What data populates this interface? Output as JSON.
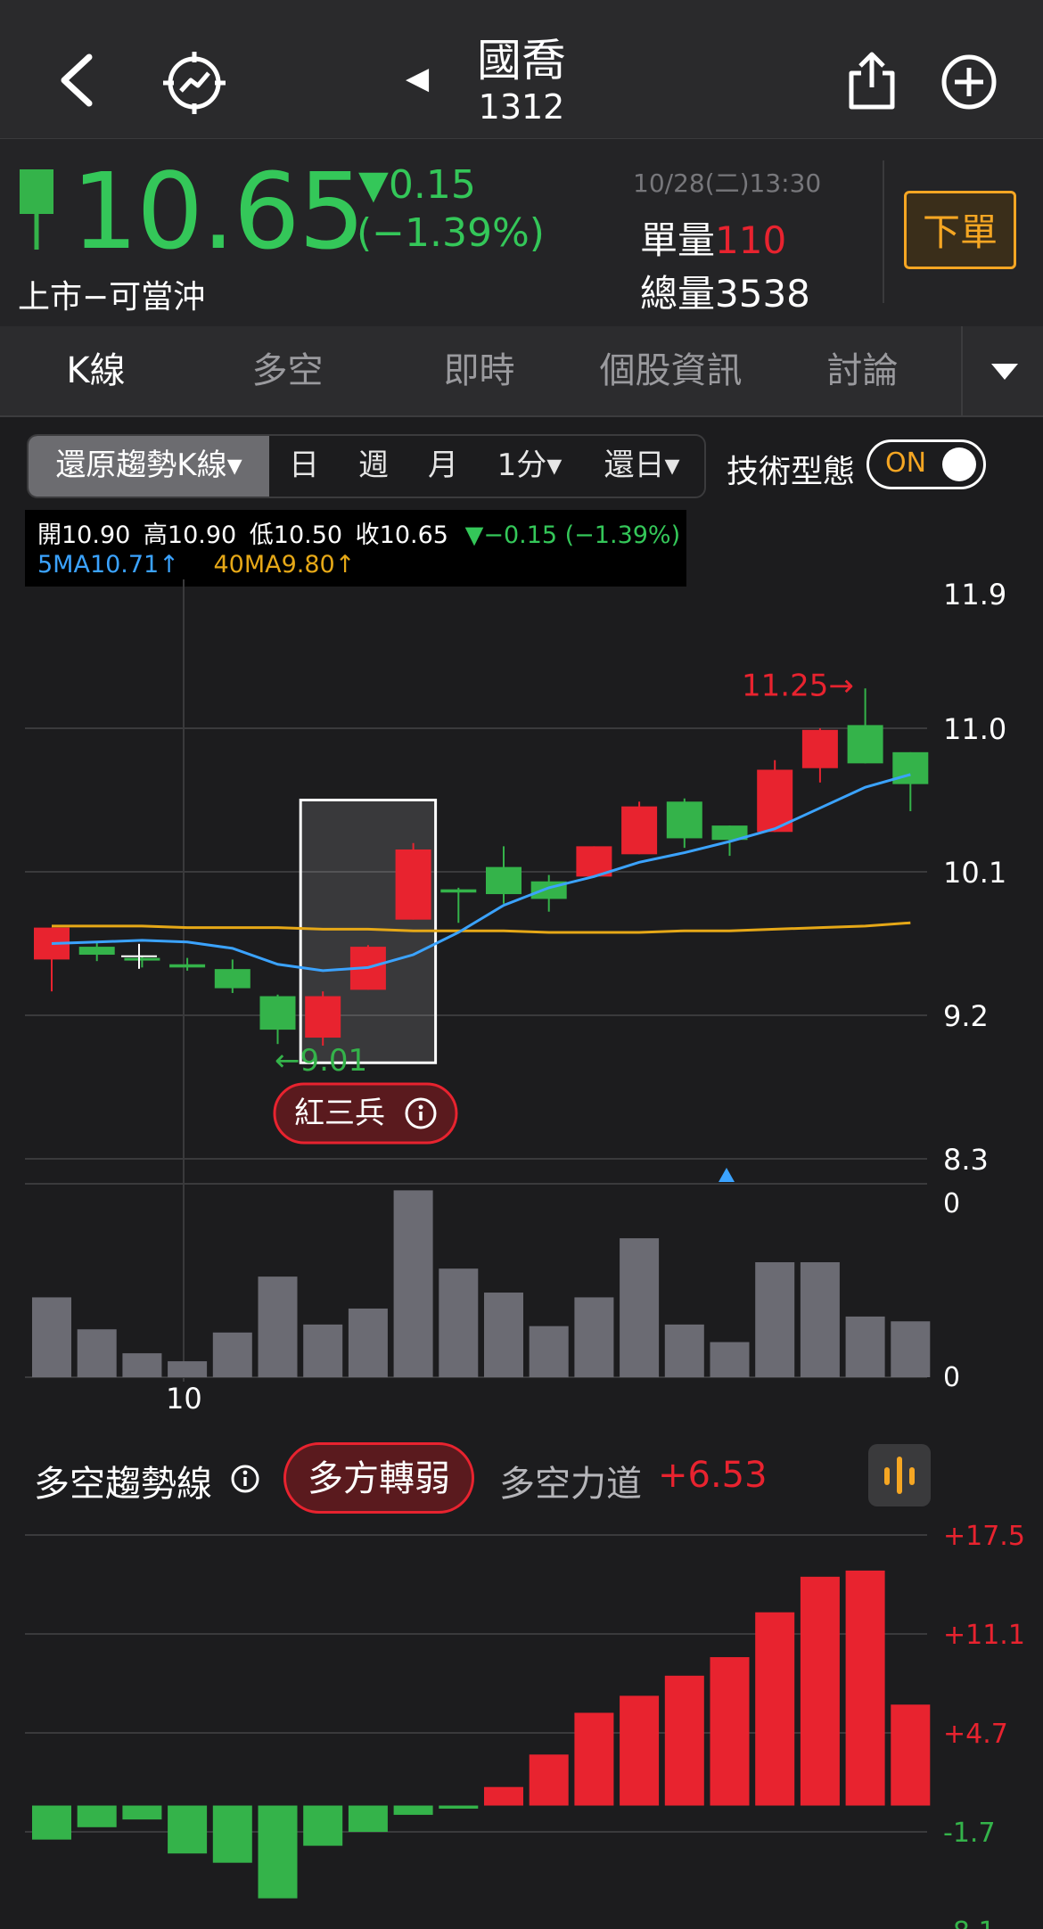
{
  "header": {
    "stock_name": "國喬",
    "stock_code": "1312",
    "prev_arrow": "◀",
    "icons": [
      "back-icon",
      "trend-target-icon",
      "share-icon",
      "add-icon"
    ]
  },
  "quote": {
    "price": "10.65",
    "change": "▼0.15",
    "change_pct": "(−1.39%)",
    "market": "上市−可當沖",
    "datetime": "10/28(二)13:30",
    "unit_volume_label": "單量",
    "unit_volume": "110",
    "total_volume_label": "總量",
    "total_volume": "3538",
    "order_button": "下單"
  },
  "tabs": [
    "K線",
    "多空",
    "即時",
    "個股資訊",
    "討論"
  ],
  "toolbar": {
    "kline_mode": "還原趨勢K線▾",
    "periods": [
      "日",
      "週",
      "月",
      "1分▾",
      "還日▾"
    ],
    "tech_label": "技術型態",
    "toggle": "ON"
  },
  "ohlc_bar": {
    "open": "開10.90",
    "high": "高10.90",
    "low": "低10.50",
    "close": "收10.65",
    "change": "▼−0.15 (−1.39%)",
    "ma5": "5MA10.71↑",
    "ma40": "40MA9.80↑"
  },
  "price_chart": {
    "y_ticks": [
      "11.9",
      "11.0",
      "10.1",
      "9.2",
      "8.3"
    ],
    "x_label": "10",
    "high_annotation": "11.25→",
    "low_annotation": "←9.01",
    "pattern_label": "紅三兵",
    "vol_ticks": [
      "0",
      "0"
    ]
  },
  "chart_data": [
    {
      "type": "candlestick",
      "ylim": [
        8.3,
        11.9
      ],
      "candles": [
        {
          "o": 9.55,
          "h": 9.71,
          "l": 9.35,
          "c": 9.75,
          "dir": "up"
        },
        {
          "o": 9.63,
          "h": 9.66,
          "l": 9.54,
          "c": 9.58,
          "dir": "down"
        },
        {
          "o": 9.56,
          "h": 9.57,
          "l": 9.5,
          "c": 9.56,
          "dir": "down"
        },
        {
          "o": 9.52,
          "h": 9.56,
          "l": 9.48,
          "c": 9.5,
          "dir": "down"
        },
        {
          "o": 9.49,
          "h": 9.55,
          "l": 9.34,
          "c": 9.37,
          "dir": "down"
        },
        {
          "o": 9.32,
          "h": 9.33,
          "l": 9.02,
          "c": 9.11,
          "dir": "down"
        },
        {
          "o": 9.06,
          "h": 9.35,
          "l": 9.01,
          "c": 9.32,
          "dir": "up"
        },
        {
          "o": 9.36,
          "h": 9.64,
          "l": 9.36,
          "c": 9.63,
          "dir": "up"
        },
        {
          "o": 9.8,
          "h": 10.28,
          "l": 9.8,
          "c": 10.24,
          "dir": "up"
        },
        {
          "o": 9.99,
          "h": 10.0,
          "l": 9.78,
          "c": 9.97,
          "dir": "down"
        },
        {
          "o": 10.13,
          "h": 10.26,
          "l": 9.9,
          "c": 9.96,
          "dir": "down"
        },
        {
          "o": 10.04,
          "h": 10.08,
          "l": 9.85,
          "c": 9.93,
          "dir": "down"
        },
        {
          "o": 10.07,
          "h": 10.19,
          "l": 10.07,
          "c": 10.26,
          "dir": "up"
        },
        {
          "o": 10.21,
          "h": 10.54,
          "l": 10.21,
          "c": 10.51,
          "dir": "up"
        },
        {
          "o": 10.54,
          "h": 10.56,
          "l": 10.25,
          "c": 10.31,
          "dir": "down"
        },
        {
          "o": 10.39,
          "h": 10.39,
          "l": 10.2,
          "c": 10.3,
          "dir": "down"
        },
        {
          "o": 10.35,
          "h": 10.8,
          "l": 10.35,
          "c": 10.74,
          "dir": "up"
        },
        {
          "o": 10.75,
          "h": 11.0,
          "l": 10.66,
          "c": 10.99,
          "dir": "up"
        },
        {
          "o": 11.02,
          "h": 11.25,
          "l": 10.78,
          "c": 10.78,
          "dir": "down"
        },
        {
          "o": 10.85,
          "h": 10.85,
          "l": 10.48,
          "c": 10.65,
          "dir": "down"
        }
      ],
      "ma5": [
        9.65,
        9.66,
        9.67,
        9.66,
        9.62,
        9.52,
        9.48,
        9.5,
        9.58,
        9.72,
        9.89,
        10.0,
        10.07,
        10.16,
        10.22,
        10.29,
        10.37,
        10.5,
        10.63,
        10.71
      ],
      "ma40": [
        9.76,
        9.76,
        9.76,
        9.75,
        9.75,
        9.75,
        9.74,
        9.74,
        9.73,
        9.73,
        9.73,
        9.72,
        9.72,
        9.72,
        9.73,
        9.73,
        9.74,
        9.75,
        9.76,
        9.78
      ]
    },
    {
      "type": "bar",
      "name": "volume",
      "values": [
        5.0,
        3.0,
        1.5,
        1.0,
        2.8,
        6.3,
        3.3,
        4.3,
        11.7,
        6.8,
        5.3,
        3.2,
        5.0,
        8.7,
        3.3,
        2.2,
        7.2,
        7.2,
        3.8,
        3.5
      ]
    },
    {
      "type": "bar",
      "name": "多空力道",
      "y_ticks": [
        "+17.5",
        "+11.1",
        "+4.7",
        "-1.7",
        "-8.1"
      ],
      "ylim": [
        -8.1,
        17.5
      ],
      "values": [
        -2.2,
        -1.4,
        -0.9,
        -3.1,
        -3.7,
        -6.0,
        -2.6,
        -1.7,
        -0.6,
        -0.2,
        1.2,
        3.3,
        6.0,
        7.1,
        8.4,
        9.6,
        12.5,
        14.8,
        15.2,
        6.53
      ]
    }
  ],
  "trend_section": {
    "title": "多空趨勢線",
    "badge": "多方轉弱",
    "strength_label": "多空力道",
    "strength_value": "+6.53"
  },
  "colors": {
    "up": "#e8232f",
    "down": "#34b34a",
    "ma5": "#3ba3ff",
    "ma40": "#e6a817",
    "accent": "#f5a623"
  }
}
